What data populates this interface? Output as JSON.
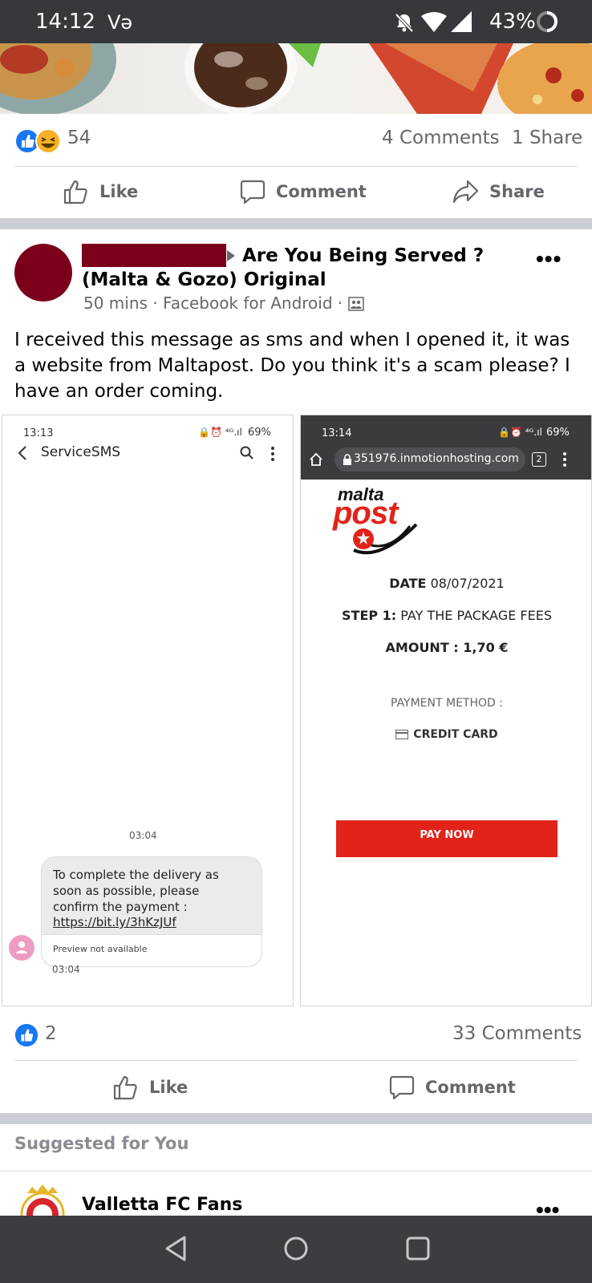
{
  "status_bar": {
    "time": "14:12",
    "carrier": "Və",
    "battery": "43%"
  },
  "prev_post": {
    "reaction_count": "54",
    "comments": "4 Comments",
    "shares": "1 Share",
    "actions": {
      "like": "Like",
      "comment": "Comment",
      "share": "Share"
    }
  },
  "post": {
    "group": "Are You Being Served ? (Malta & Gozo) Original",
    "time": "50 mins",
    "via": "Facebook for Android",
    "text": "I received this message as sms and when I opened it, it was a website from Maltapost. Do you think it's a scam please? I have an order coming.",
    "reaction_count": "2",
    "comments": "33 Comments",
    "actions": {
      "like": "Like",
      "comment": "Comment"
    }
  },
  "sms_screenshot": {
    "time": "13:13",
    "battery": "69%",
    "title": "ServiceSMS",
    "date_label": "03:04",
    "message": "To complete the delivery as soon as possible, please confirm the payment :",
    "link": "https://bit.ly/3hKzJUf",
    "preview": "Preview not available",
    "msg_time": "03:04"
  },
  "web_screenshot": {
    "time": "13:14",
    "battery": "69%",
    "url": "351976.inmotionhosting.com",
    "tabs": "2",
    "logo_top": "malta",
    "logo_bottom": "post",
    "date_label": "DATE",
    "date_value": "08/07/2021",
    "step_label": "STEP 1:",
    "step_value": "PAY THE PACKAGE FEES",
    "amount": "AMOUNT : 1,70 €",
    "payment_method": "PAYMENT METHOD :",
    "credit_card": "CREDIT CARD",
    "pay_button": "PAY NOW"
  },
  "suggested": {
    "heading": "Suggested for You",
    "page_name": "Valletta FC Fans"
  },
  "colors": {
    "fb_blue": "#1877f2",
    "redaction": "#7b0019",
    "pay_red": "#e2231a",
    "divider": "#cbcfd5"
  }
}
